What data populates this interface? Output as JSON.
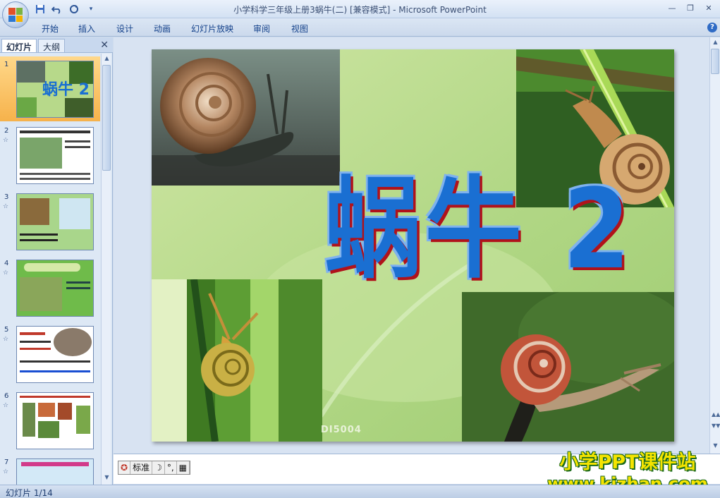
{
  "window": {
    "title": "小学科学三年级上册3蜗牛(二) [兼容模式] - Microsoft PowerPoint"
  },
  "quick_access": [
    "save-icon",
    "undo-icon",
    "redo-icon",
    "customize-icon"
  ],
  "ribbon": {
    "tabs": [
      "开始",
      "插入",
      "设计",
      "动画",
      "幻灯片放映",
      "审阅",
      "视图"
    ]
  },
  "left_panel": {
    "tabs": [
      "幻灯片",
      "大纲"
    ],
    "thumbnails": [
      {
        "number": "1",
        "star": ""
      },
      {
        "number": "2",
        "star": "☆"
      },
      {
        "number": "3",
        "star": "☆"
      },
      {
        "number": "4",
        "star": "☆"
      },
      {
        "number": "5",
        "star": "☆"
      },
      {
        "number": "6",
        "star": "☆"
      },
      {
        "number": "7",
        "star": "☆"
      }
    ]
  },
  "slide": {
    "title": "蜗牛 2",
    "code": "DI5004"
  },
  "ime_bar": {
    "mode": "标准",
    "items": [
      "☽",
      "°,",
      "▦"
    ]
  },
  "status": {
    "slide_indicator": "幻灯片 1/14"
  },
  "watermark": {
    "line1": "小学PPT课件站",
    "line2": "www.kjzhan.com"
  },
  "colors": {
    "accent": "#1a6fd2",
    "selected_thumb": "#f6b24b",
    "watermark": "#f5e400"
  }
}
